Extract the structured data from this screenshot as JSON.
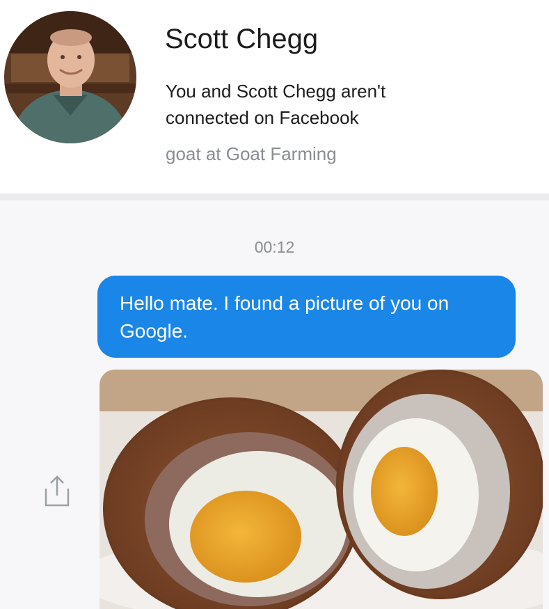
{
  "contact": {
    "name": "Scott Chegg",
    "connection_note": "You and Scott Chegg aren't connected on Facebook",
    "work": "goat at Goat Farming"
  },
  "thread": {
    "timestamp": "00:12",
    "messages": [
      {
        "text": "Hello mate. I found a picture of you on Google.",
        "sender": "me"
      }
    ],
    "attachment": {
      "subject": "scotch egg cut in half"
    }
  },
  "icons": {
    "share": "share-icon"
  },
  "colors": {
    "bubble": "#1a86e8",
    "bubble_text": "#ffffff",
    "secondary_text": "#8a8d91",
    "thread_bg": "#f7f7f9"
  }
}
